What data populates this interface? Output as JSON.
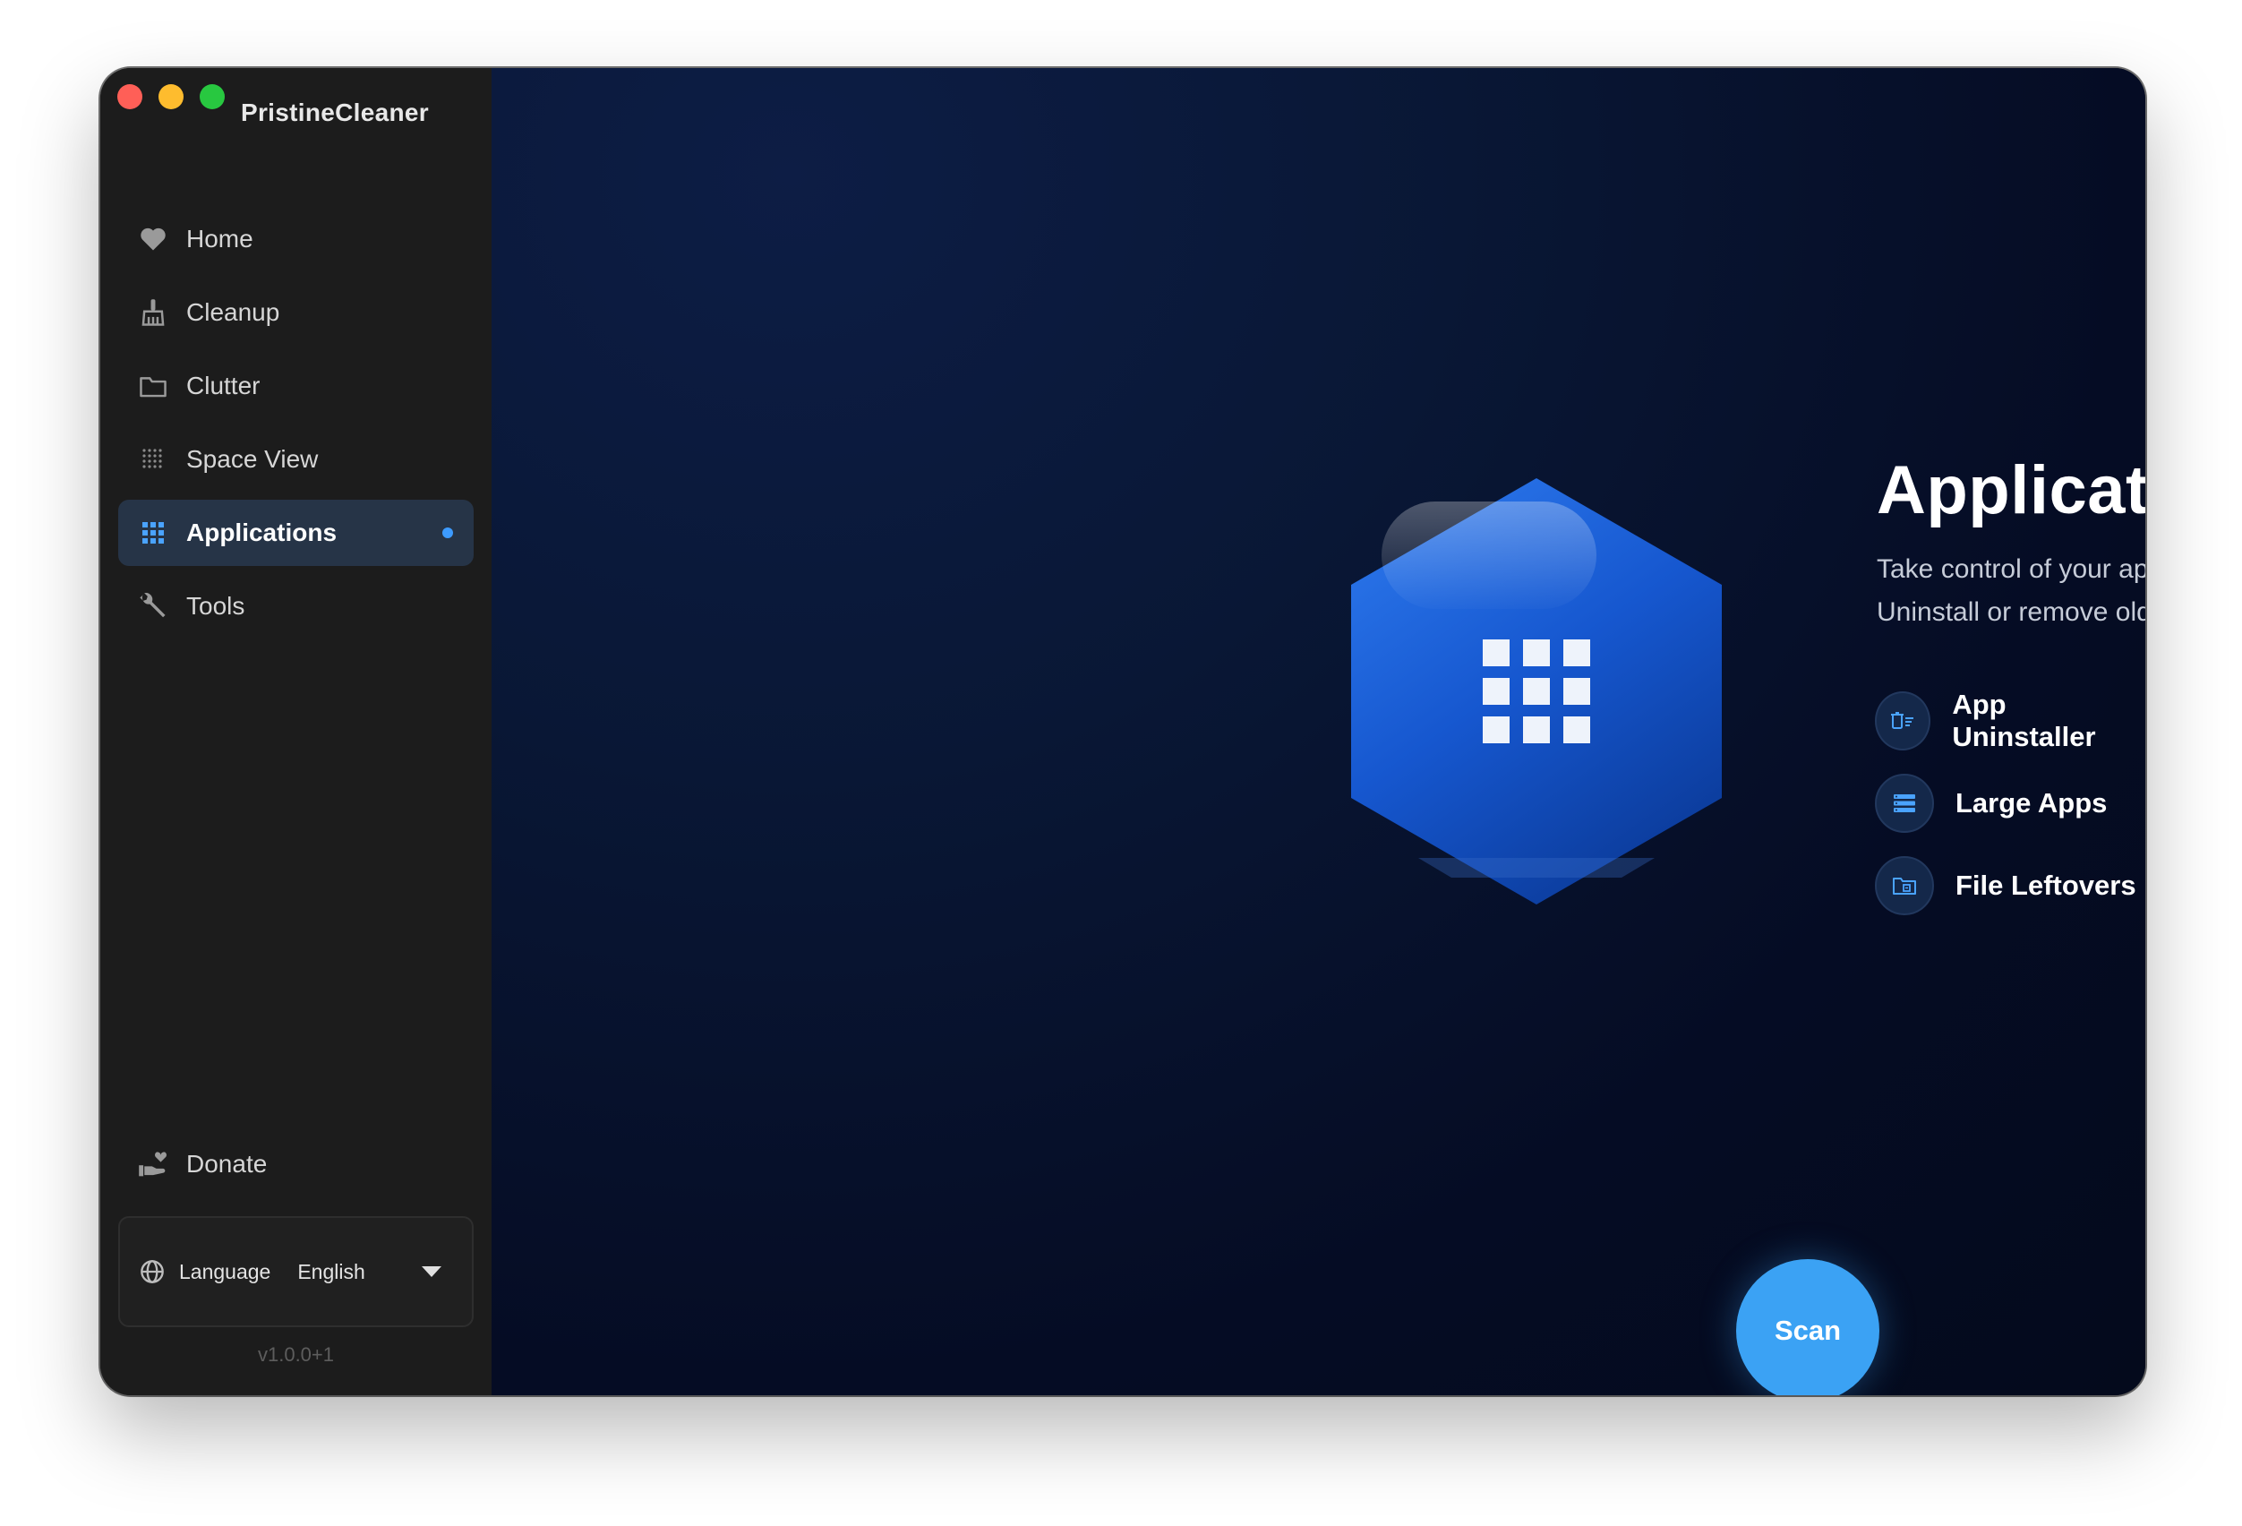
{
  "window": {
    "app_title": "PristineCleaner"
  },
  "sidebar": {
    "items": [
      {
        "label": "Home",
        "icon": "heart-icon"
      },
      {
        "label": "Cleanup",
        "icon": "broom-icon"
      },
      {
        "label": "Clutter",
        "icon": "folder-icon"
      },
      {
        "label": "Space View",
        "icon": "dot-grid-icon"
      },
      {
        "label": "Applications",
        "icon": "apps-grid-icon",
        "active": true
      },
      {
        "label": "Tools",
        "icon": "wrench-icon"
      }
    ],
    "donate": {
      "label": "Donate",
      "icon": "donate-hand-icon"
    },
    "language": {
      "label": "Language",
      "value": "English",
      "icon": "globe-icon"
    },
    "version": "v1.0.0+1"
  },
  "main": {
    "title": "Applications",
    "subtitle_lines": [
      "Take control of your applications.",
      "Uninstall or remove old leftovers."
    ],
    "features": [
      {
        "label": "App Uninstaller",
        "icon": "uninstall-icon"
      },
      {
        "label": "Large Apps",
        "icon": "list-stack-icon"
      },
      {
        "label": "File Leftovers",
        "icon": "folder-file-icon"
      }
    ],
    "scan_label": "Scan"
  },
  "colors": {
    "accent": "#3ba2f4",
    "active_dot": "#3d9bff",
    "sidebar_bg": "#1c1c1c",
    "active_item_bg": "#263447",
    "main_bg": "#060e28"
  }
}
